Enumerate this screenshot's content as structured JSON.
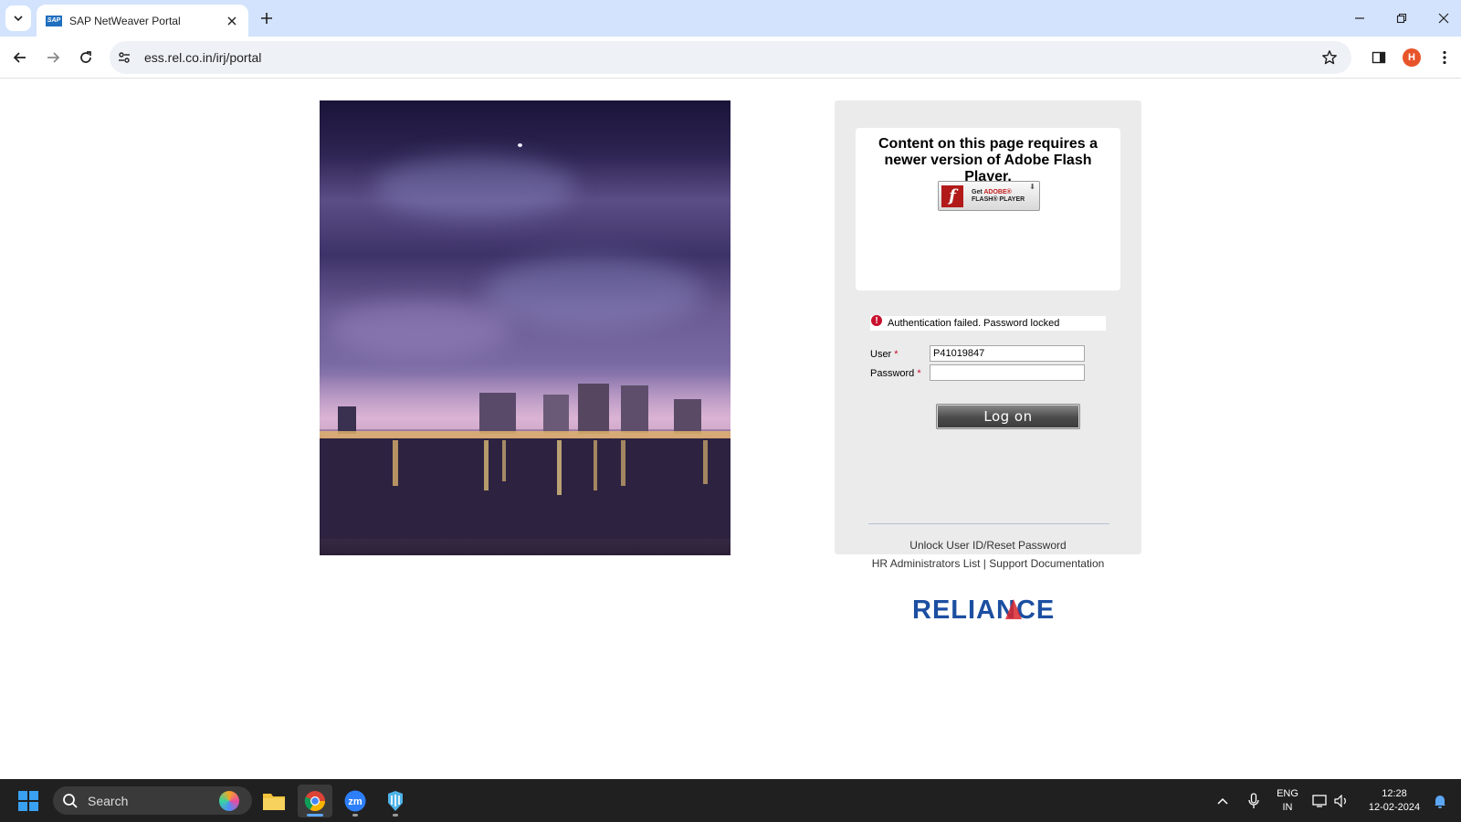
{
  "browser": {
    "tab_title": "SAP NetWeaver Portal",
    "tab_favicon": "SAP",
    "url": "ess.rel.co.in/irj/portal",
    "profile_initial": "H"
  },
  "page": {
    "flash_message": "Content on this page requires a newer version of Adobe Flash Player.",
    "flash_button": {
      "line1_prefix": "Get ",
      "line1_brand": "ADOBE®",
      "line2": "FLASH® PLAYER",
      "logo": "f"
    },
    "error_message": "Authentication failed. Password locked",
    "user_label": "User",
    "password_label": "Password",
    "required_marker": "*",
    "user_value": "P41019847",
    "password_value": "",
    "logon_label": "Log on",
    "unlock_link": "Unlock User ID/Reset Password",
    "hr_admin_link": "HR Administrators List",
    "separator": "|",
    "support_link": "Support Documentation",
    "logo_text": "RELIANCE"
  },
  "taskbar": {
    "search_placeholder": "Search",
    "lang_line1": "ENG",
    "lang_line2": "IN",
    "time": "12:28",
    "date": "12-02-2024"
  },
  "colors": {
    "tabbar_bg": "#d3e3fd",
    "panel_bg": "#ebebeb",
    "error_red": "#c8102e",
    "reliance_blue": "#1c4fa1",
    "reliance_red": "#d9272e",
    "taskbar_bg": "#202020"
  }
}
